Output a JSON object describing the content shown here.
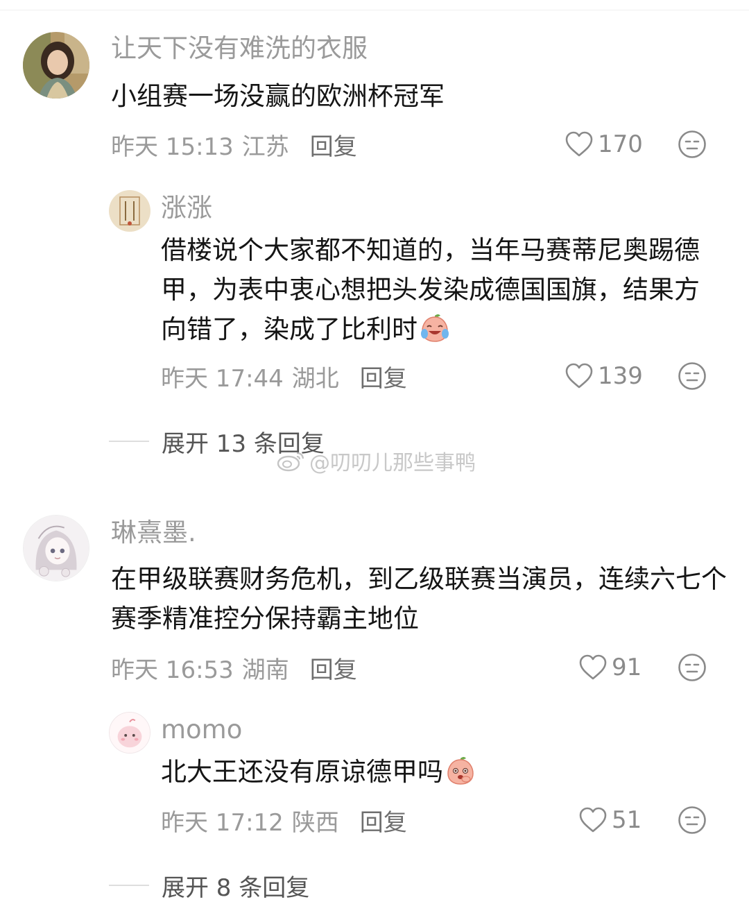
{
  "comments": [
    {
      "user": "让天下没有难洗的衣服",
      "text": "小组赛一场没赢的欧洲杯冠军",
      "time": "昨天 15:13",
      "location": "江苏",
      "reply_label": "回复",
      "likes": "170",
      "avatar_icon": "portrait-avatar-icon",
      "replies": [
        {
          "user": "涨涨",
          "text": "借楼说个大家都不知道的，当年马赛蒂尼奥踢德甲，为表中衷心想把头发染成德国国旗，结果方向错了，染成了比利时",
          "emoji": "laughing-tears-peach-emoji",
          "time": "昨天 17:44",
          "location": "湖北",
          "reply_label": "回复",
          "likes": "139"
        }
      ],
      "expand_label": "展开 13 条回复"
    },
    {
      "user": "琳熹墨.",
      "text": "在甲级联赛财务危机，到乙级联赛当演员，连续六七个赛季精准控分保持霸主地位",
      "time": "昨天 16:53",
      "location": "湖南",
      "reply_label": "回复",
      "likes": "91",
      "avatar_icon": "anime-girl-avatar-icon",
      "replies": [
        {
          "user": "momo",
          "text": "北大王还没有原谅德甲吗",
          "emoji": "shy-peach-emoji",
          "time": "昨天 17:12",
          "location": "陕西",
          "reply_label": "回复",
          "likes": "51"
        }
      ],
      "expand_label": "展开 8 条回复"
    }
  ],
  "watermark": "@叨叨儿那些事鸭",
  "colors": {
    "meta_gray": "#9a9a9a",
    "text_dark": "#151515",
    "icon_gray": "#8a8a8a"
  }
}
